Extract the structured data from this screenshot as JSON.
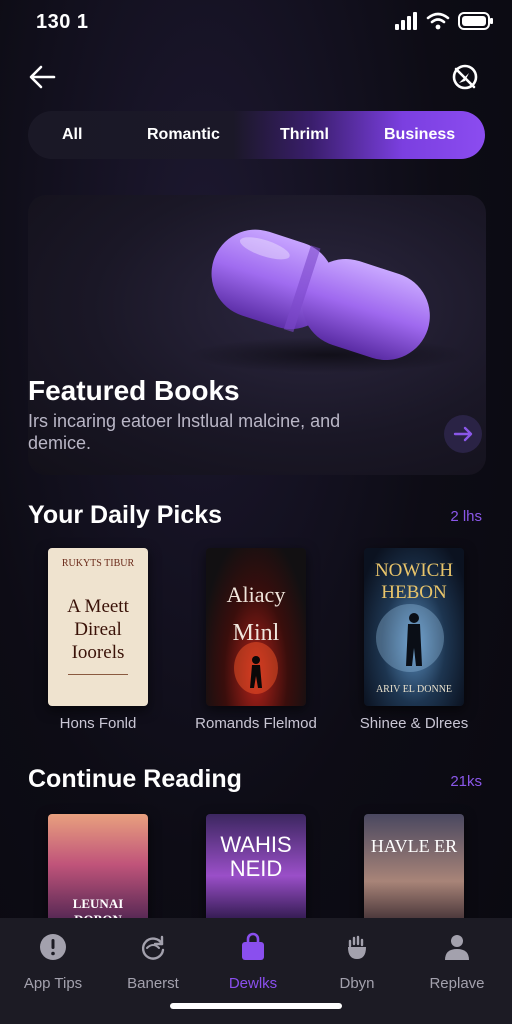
{
  "status_bar": {
    "time": "130 1"
  },
  "filters": {
    "tabs": [
      {
        "label": "All"
      },
      {
        "label": "Romantic"
      },
      {
        "label": "Thriml"
      },
      {
        "label": "Business"
      }
    ],
    "active": "Business"
  },
  "featured": {
    "title": "Featured Books",
    "description": "Irs incaring eatoer lnstlual malcine, and demice."
  },
  "daily_picks": {
    "title": "Your Daily Picks",
    "count": "2 lhs",
    "books": [
      {
        "caption": "Hons Fonld",
        "cover_header": "RUKYTS TIBUR",
        "cover_title_1": "A Meett",
        "cover_title_2": "Direal",
        "cover_title_3": "Ioorels"
      },
      {
        "caption": "Romands Flelmod",
        "cover_title_1": "Aliacy",
        "cover_title_2": "Minl"
      },
      {
        "caption": "Shinee & Dlrees",
        "cover_title_1": "NOWICH",
        "cover_title_2": "HEBON",
        "cover_author": "ARIV EL DONNE"
      }
    ]
  },
  "continue_reading": {
    "title": "Continue Reading",
    "count": "21ks",
    "books": [
      {
        "cover_title": "LEUNAI DOBON"
      },
      {
        "cover_title_1": "WAHIS",
        "cover_title_2": "NEID"
      },
      {
        "cover_title": "HAVLE ER"
      }
    ]
  },
  "bottom_nav": {
    "items": [
      {
        "label": "App Tips",
        "icon": "alert-circle-icon"
      },
      {
        "label": "Banerst",
        "icon": "refresh-icon"
      },
      {
        "label": "Dewlks",
        "icon": "bag-icon"
      },
      {
        "label": "Dbyn",
        "icon": "hand-icon"
      },
      {
        "label": "Replave",
        "icon": "person-icon"
      }
    ],
    "active": "Dewlks"
  },
  "colors": {
    "accent": "#8a4fee",
    "background": "#0d0c15",
    "nav_background": "#1c1b24"
  }
}
